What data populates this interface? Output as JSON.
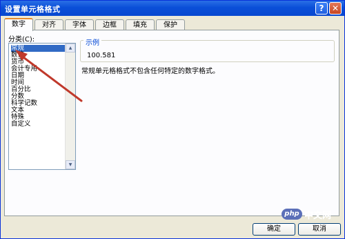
{
  "window": {
    "title": "设置单元格格式"
  },
  "title_buttons": {
    "help": "?",
    "close": "✕"
  },
  "tabs": [
    "数字",
    "对齐",
    "字体",
    "边框",
    "填充",
    "保护"
  ],
  "category": {
    "label": "分类(C):",
    "items": [
      "常规",
      "数值",
      "货币",
      "会计专用",
      "日期",
      "时间",
      "百分比",
      "分数",
      "科学记数",
      "文本",
      "特殊",
      "自定义"
    ],
    "selected": "常规"
  },
  "sample": {
    "legend": "示例",
    "value": "100.581"
  },
  "description": "常规单元格格式不包含任何特定的数字格式。",
  "buttons": {
    "ok": "确定",
    "cancel": "取消"
  },
  "watermark": {
    "logo": "php",
    "text": "中文网"
  },
  "colors": {
    "title_bar": "#0a4fd8",
    "selection": "#316ac5",
    "arrow": "#c0392b"
  }
}
